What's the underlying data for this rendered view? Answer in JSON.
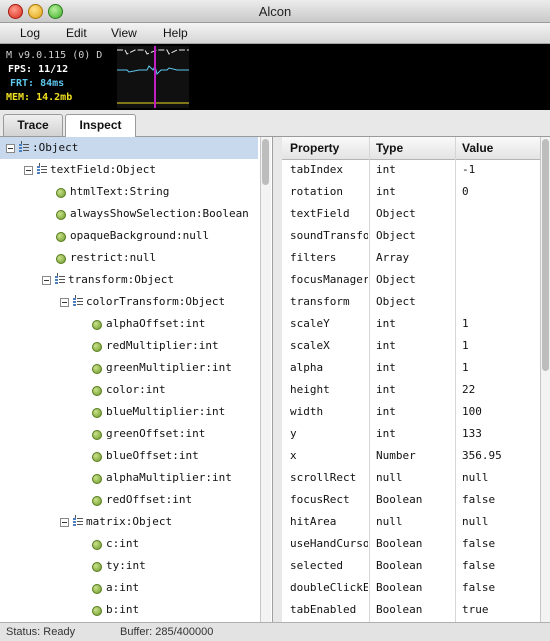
{
  "window": {
    "title": "Alcon"
  },
  "menu": {
    "items": [
      "Log",
      "Edit",
      "View",
      "Help"
    ]
  },
  "stats": {
    "version": "M v9.0.115 (0) D",
    "fps": "FPS: 11/12",
    "frt": "FRT: 84ms",
    "mem": "MEM: 14.2mb"
  },
  "tabs": [
    "Trace",
    "Inspect"
  ],
  "active_tab": "Inspect",
  "tree": {
    "rows": [
      {
        "label": ":Object",
        "kind": "object",
        "expanded": true,
        "depth": 0
      },
      {
        "label": "textField:Object",
        "kind": "object",
        "expanded": true,
        "depth": 1
      },
      {
        "label": "htmlText:String",
        "kind": "leaf",
        "depth": 2
      },
      {
        "label": "alwaysShowSelection:Boolean",
        "kind": "leaf",
        "depth": 2
      },
      {
        "label": "opaqueBackground:null",
        "kind": "leaf",
        "depth": 2
      },
      {
        "label": "restrict:null",
        "kind": "leaf",
        "depth": 2
      },
      {
        "label": "transform:Object",
        "kind": "object",
        "expanded": true,
        "depth": 2
      },
      {
        "label": "colorTransform:Object",
        "kind": "object",
        "expanded": true,
        "depth": 3
      },
      {
        "label": "alphaOffset:int",
        "kind": "leaf",
        "depth": 4
      },
      {
        "label": "redMultiplier:int",
        "kind": "leaf",
        "depth": 4
      },
      {
        "label": "greenMultiplier:int",
        "kind": "leaf",
        "depth": 4
      },
      {
        "label": "color:int",
        "kind": "leaf",
        "depth": 4
      },
      {
        "label": "blueMultiplier:int",
        "kind": "leaf",
        "depth": 4
      },
      {
        "label": "greenOffset:int",
        "kind": "leaf",
        "depth": 4
      },
      {
        "label": "blueOffset:int",
        "kind": "leaf",
        "depth": 4
      },
      {
        "label": "alphaMultiplier:int",
        "kind": "leaf",
        "depth": 4
      },
      {
        "label": "redOffset:int",
        "kind": "leaf",
        "depth": 4
      },
      {
        "label": "matrix:Object",
        "kind": "object",
        "expanded": true,
        "depth": 3
      },
      {
        "label": "c:int",
        "kind": "leaf",
        "depth": 4
      },
      {
        "label": "ty:int",
        "kind": "leaf",
        "depth": 4
      },
      {
        "label": "a:int",
        "kind": "leaf",
        "depth": 4
      },
      {
        "label": "b:int",
        "kind": "leaf",
        "depth": 4
      }
    ]
  },
  "table": {
    "headers": [
      "Property",
      "Type",
      "Value"
    ],
    "rows": [
      [
        "tabIndex",
        "int",
        "-1"
      ],
      [
        "rotation",
        "int",
        "0"
      ],
      [
        "textField",
        "Object",
        ""
      ],
      [
        "soundTransfo",
        "Object",
        ""
      ],
      [
        "filters",
        "Array",
        ""
      ],
      [
        "focusManager",
        "Object",
        ""
      ],
      [
        "transform",
        "Object",
        ""
      ],
      [
        "scaleY",
        "int",
        "1"
      ],
      [
        "scaleX",
        "int",
        "1"
      ],
      [
        "alpha",
        "int",
        "1"
      ],
      [
        "height",
        "int",
        "22"
      ],
      [
        "width",
        "int",
        "100"
      ],
      [
        "y",
        "int",
        "133"
      ],
      [
        "x",
        "Number",
        "356.95"
      ],
      [
        "scrollRect",
        "null",
        "null"
      ],
      [
        "focusRect",
        "Boolean",
        "false"
      ],
      [
        "hitArea",
        "null",
        "null"
      ],
      [
        "useHandCurso",
        "Boolean",
        "false"
      ],
      [
        "selected",
        "Boolean",
        "false"
      ],
      [
        "doubleClickEn",
        "Boolean",
        "false"
      ],
      [
        "tabEnabled",
        "Boolean",
        "true"
      ]
    ]
  },
  "status": {
    "state": "Status: Ready",
    "buffer": "Buffer: 285/400000"
  },
  "colors": {
    "fps": "#ffffff",
    "frt": "#5ec8f0",
    "mem": "#f0e020",
    "graph_fps": "#e8e8e8",
    "graph_frt": "#5ec8f0",
    "graph_mem": "#f0e020",
    "graph_marker": "#c020c0",
    "selection": "#c8d9ee"
  }
}
